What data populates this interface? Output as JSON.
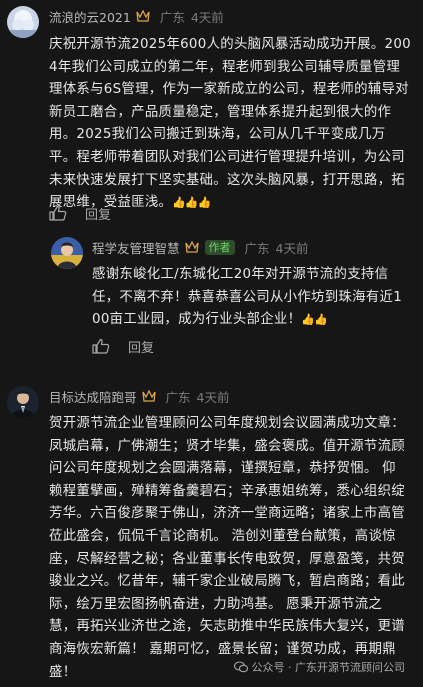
{
  "comments": [
    {
      "user": "流浪的云2021",
      "location": "广东",
      "time": "4天前",
      "lines": [
        "庆祝开源节流2025年600人的头脑风暴活动成功开展。200",
        "4年我们公司成立的第二年，程老师到我公司辅导质量管理",
        "理体系与6S管理，作为一家新成立的公司，程老师的辅导对",
        "新员工磨合，产品质量稳定，管理体系提升起到很大的作",
        "用。2025我们公司搬迁到珠海，公司从几千平变成几万",
        "平。程老师带着团队对我们公司进行管理提升培训，为公司",
        "未来快速发展打下坚实基础。这次头脑风暴，打开思路，拓",
        "展思维，受益匪浅。"
      ],
      "emoji": "👍👍👍",
      "reply_label": "回复"
    },
    {
      "user": "程学友管理智慧",
      "badge": "作者",
      "location": "广东",
      "time": "4天前",
      "lines": [
        "感谢东峻化工/东城化工20年对开源节流的支持信",
        "任，不离不弃！恭喜恭喜公司从小作坊到珠海有近1",
        "00亩工业园，成为行业头部企业！"
      ],
      "emoji": "👍👍",
      "reply_label": "回复"
    },
    {
      "user": "目标达成陪跑哥",
      "location": "广东",
      "time": "4天前",
      "lines": [
        "贺开源节流企业管理顾问公司年度规划会议圆满成功文章：",
        "凤城启幕，广佛潮生；贤才毕集，盛会褒成。值开源节流顾",
        "问公司年度规划之会圆满落幕，谨撰短章，恭抒贺悃。 仰",
        "赖程董擘画，殚精筹备羹碧石；辛承惠姐统筹，悉心组织绽",
        "芳华。六百俊彦聚于佛山，济济一堂商远略；诸家上市高管",
        "莅此盛会，侃侃千言论商机。 浩创刘董登台献策，高谈惊",
        "座，尽解经营之秘；各业董事长传电致贺，厚意盈笺，共贺",
        "骏业之兴。忆昔年，辅千家企业破局腾飞，暂启商路；看此",
        "际，绘万里宏图扬帆奋进，力助鸿基。 愿秉开源节流之",
        "慧，再拓兴业济世之途，矢志助推中华民族伟大复兴，更谱",
        "商海恢宏新篇！ 嘉期可忆，盛景长留；谨贺功成，再期鼎",
        "盛！"
      ]
    }
  ],
  "footer": {
    "text": "公众号 · 广东开源节流顾问公司"
  }
}
